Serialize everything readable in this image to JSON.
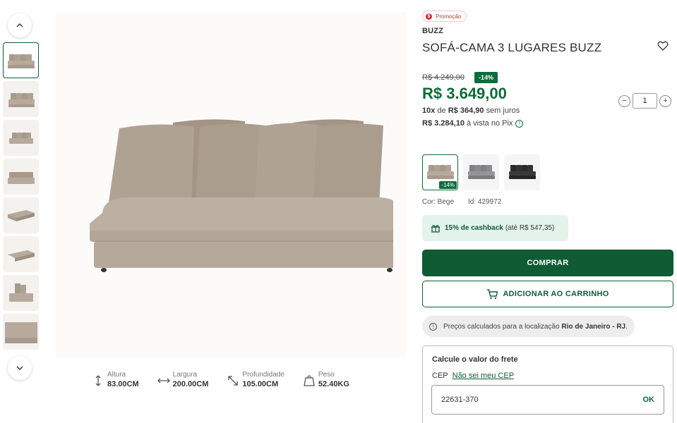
{
  "colors": {
    "brand_green": "#0e5b34",
    "price_green": "#0e6b3a",
    "promo_red": "#d6263b",
    "cashback_bg": "#e3f3ec"
  },
  "gallery": {
    "up_icon": "chevron-up-icon",
    "down_icon": "chevron-down-icon",
    "thumbnail_count": 8,
    "active_thumbnail": 1
  },
  "dimensions": [
    {
      "icon": "height-arrow-icon",
      "label": "Altura",
      "value": "83.00CM"
    },
    {
      "icon": "width-arrow-icon",
      "label": "Largura",
      "value": "200.00CM"
    },
    {
      "icon": "depth-arrow-icon",
      "label": "Profundidade",
      "value": "105.00CM"
    },
    {
      "icon": "weight-icon",
      "label": "Peso",
      "value": "52.40KG"
    }
  ],
  "product": {
    "promo_label": "Promoção",
    "brand": "BUZZ",
    "title": "SOFÁ-CAMA 3 LUGARES BUZZ",
    "old_price": "R$ 4.249,00",
    "discount": "-14%",
    "price": "R$ 3.649,00",
    "installments_count": "10x",
    "installments_of": "de",
    "installment_value": "R$ 364,90",
    "installments_suffix": "sem juros",
    "pix_price": "R$ 3.284,10",
    "pix_suffix": "à vista no Pix",
    "quantity": "1",
    "color_label": "Cor: Bege",
    "id_label": "Id: 429972",
    "swatches": [
      {
        "color": "#b3a89b",
        "badge": "-14%"
      },
      {
        "color": "#8a8a8e",
        "badge": ""
      },
      {
        "color": "#2b2b2b",
        "badge": ""
      }
    ]
  },
  "cashback": {
    "highlight": "15% de cashback",
    "detail": "(até R$ 547,35)"
  },
  "actions": {
    "buy": "COMPRAR",
    "add_to_cart": "ADICIONAR AO CARRINHO"
  },
  "location": {
    "text": "Preços calculados para a localização",
    "place": "Rio de Janeiro - RJ",
    "suffix": "."
  },
  "freight": {
    "title": "Calcule o valor do frete",
    "cep_label": "CEP",
    "cep_link": "Não sei meu CEP",
    "cep_value": "22631-370",
    "ok_label": "OK"
  }
}
